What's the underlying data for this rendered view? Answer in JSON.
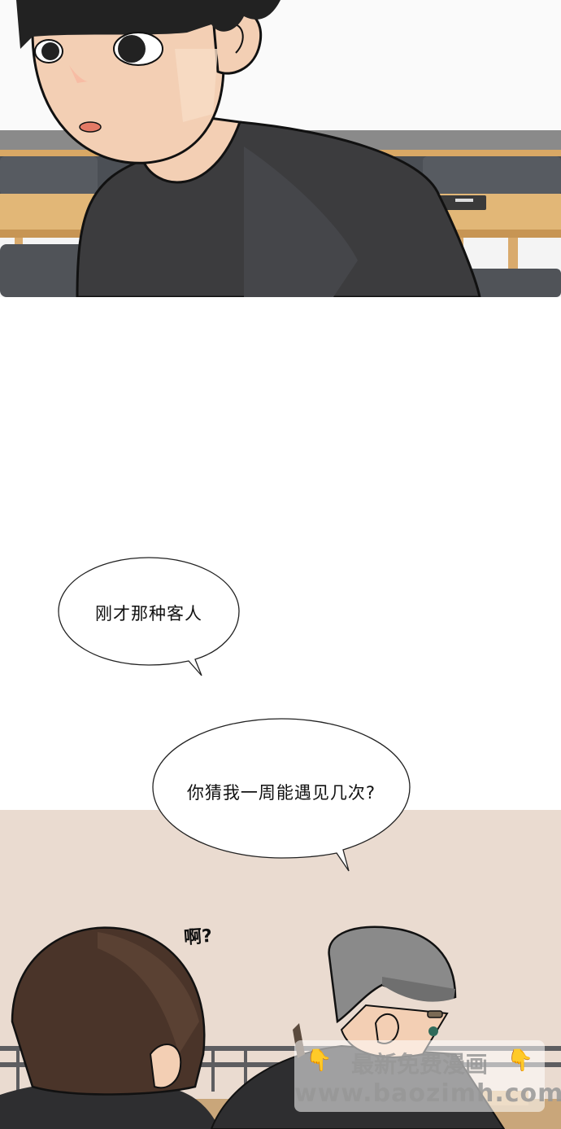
{
  "panels": {
    "top": {
      "description_label": ""
    },
    "bottom": {
      "description_label": ""
    }
  },
  "dialogue": {
    "bubble1": "刚才那种客人",
    "bubble2": "你猜我一周能遇见几次?"
  },
  "sfx": {
    "ah": "啊?"
  },
  "watermark": {
    "line1": "最新免费漫画",
    "line2": "www.baozimh.com",
    "hand_icon": "👇"
  },
  "colors": {
    "skin": "#f3cfb4",
    "hair_dark": "#222222",
    "shirt": "#3c3c3e",
    "table_wood": "#e2b777",
    "bg_beige": "#eadbd0",
    "hair_brown": "#4a3429",
    "hair_gray": "#8a8a8a"
  }
}
